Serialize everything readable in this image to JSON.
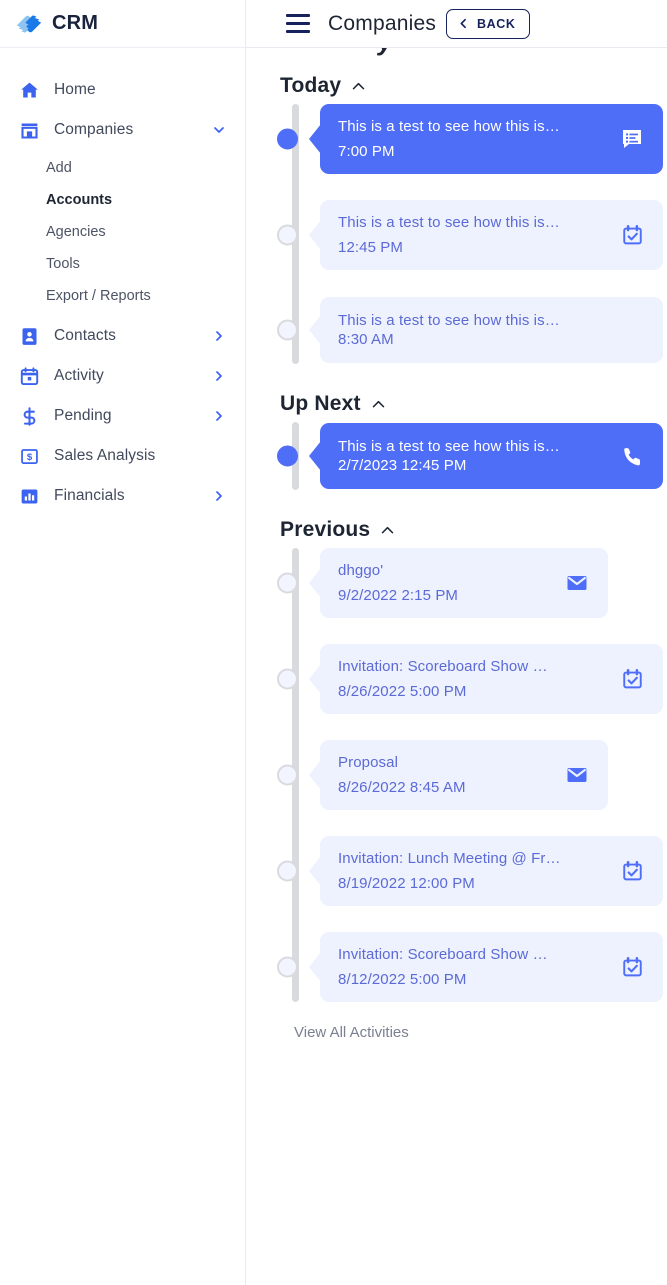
{
  "brand": {
    "name": "CRM",
    "logo_icon": "handshake-logo-icon"
  },
  "sidebar": {
    "items": [
      {
        "label": "Home",
        "icon": "home-icon",
        "caret": null,
        "expanded": false
      },
      {
        "label": "Companies",
        "icon": "store-icon",
        "caret": "chevron-down-icon",
        "expanded": true,
        "children": [
          {
            "label": "Add",
            "active": false
          },
          {
            "label": "Accounts",
            "active": true
          },
          {
            "label": "Agencies",
            "active": false
          },
          {
            "label": "Tools",
            "active": false
          },
          {
            "label": "Export / Reports",
            "active": false
          }
        ]
      },
      {
        "label": "Contacts",
        "icon": "contact-card-icon",
        "caret": "chevron-right-icon",
        "expanded": false
      },
      {
        "label": "Activity",
        "icon": "calendar-icon",
        "caret": "chevron-right-icon",
        "expanded": false
      },
      {
        "label": "Pending",
        "icon": "dollar-icon",
        "caret": "chevron-right-icon",
        "expanded": false
      },
      {
        "label": "Sales Analysis",
        "icon": "money-note-icon",
        "caret": null,
        "expanded": false
      },
      {
        "label": "Financials",
        "icon": "bar-chart-icon",
        "caret": "chevron-right-icon",
        "expanded": false
      }
    ]
  },
  "topbar": {
    "menu_icon": "hamburger-icon",
    "title": "Companies",
    "back_label": "BACK",
    "back_icon": "chevron-left-icon"
  },
  "clipped_heading": "y",
  "colors": {
    "accent": "#4f6ef7",
    "card_bg": "#eef2fe",
    "card_text": "#5b6ad6",
    "rail": "#d9dade",
    "navy": "#17225c"
  },
  "sections": [
    {
      "title": "Today",
      "chevron": "chevron-up-icon",
      "items": [
        {
          "title": "This is a test to see how this is…",
          "meta": "7:00 PM",
          "icon": "note-bubble-icon",
          "active": true,
          "width": "wide",
          "compact": false
        },
        {
          "title": "This is a test to see how this is…",
          "meta": "12:45 PM",
          "icon": "calendar-check-icon",
          "active": false,
          "width": "wide",
          "compact": false
        },
        {
          "title": "This is a test to see how this is…",
          "meta": "8:30 AM",
          "icon": null,
          "active": false,
          "width": "wide",
          "compact": true
        }
      ]
    },
    {
      "title": "Up Next",
      "chevron": "chevron-up-icon",
      "items": [
        {
          "title": "This is a test to see how this is…",
          "meta": "2/7/2023 12:45 PM",
          "icon": "phone-icon",
          "active": true,
          "width": "wide",
          "compact": true
        }
      ]
    },
    {
      "title": "Previous",
      "chevron": "chevron-up-icon",
      "items": [
        {
          "title": "dhggo'",
          "meta": "9/2/2022 2:15 PM",
          "icon": "envelope-icon",
          "active": false,
          "width": "narrow",
          "compact": false
        },
        {
          "title": "Invitation: Scoreboard Show …",
          "meta": "8/26/2022 5:00 PM",
          "icon": "calendar-check-icon",
          "active": false,
          "width": "wide",
          "compact": false
        },
        {
          "title": "Proposal",
          "meta": "8/26/2022 8:45 AM",
          "icon": "envelope-icon",
          "active": false,
          "width": "narrow",
          "compact": false
        },
        {
          "title": "Invitation: Lunch Meeting @ Fr…",
          "meta": "8/19/2022 12:00 PM",
          "icon": "calendar-check-icon",
          "active": false,
          "width": "wide",
          "compact": false
        },
        {
          "title": "Invitation: Scoreboard Show …",
          "meta": "8/12/2022 5:00 PM",
          "icon": "calendar-check-icon",
          "active": false,
          "width": "wide",
          "compact": false
        }
      ]
    }
  ],
  "footer": {
    "view_all_label": "View All Activities"
  }
}
